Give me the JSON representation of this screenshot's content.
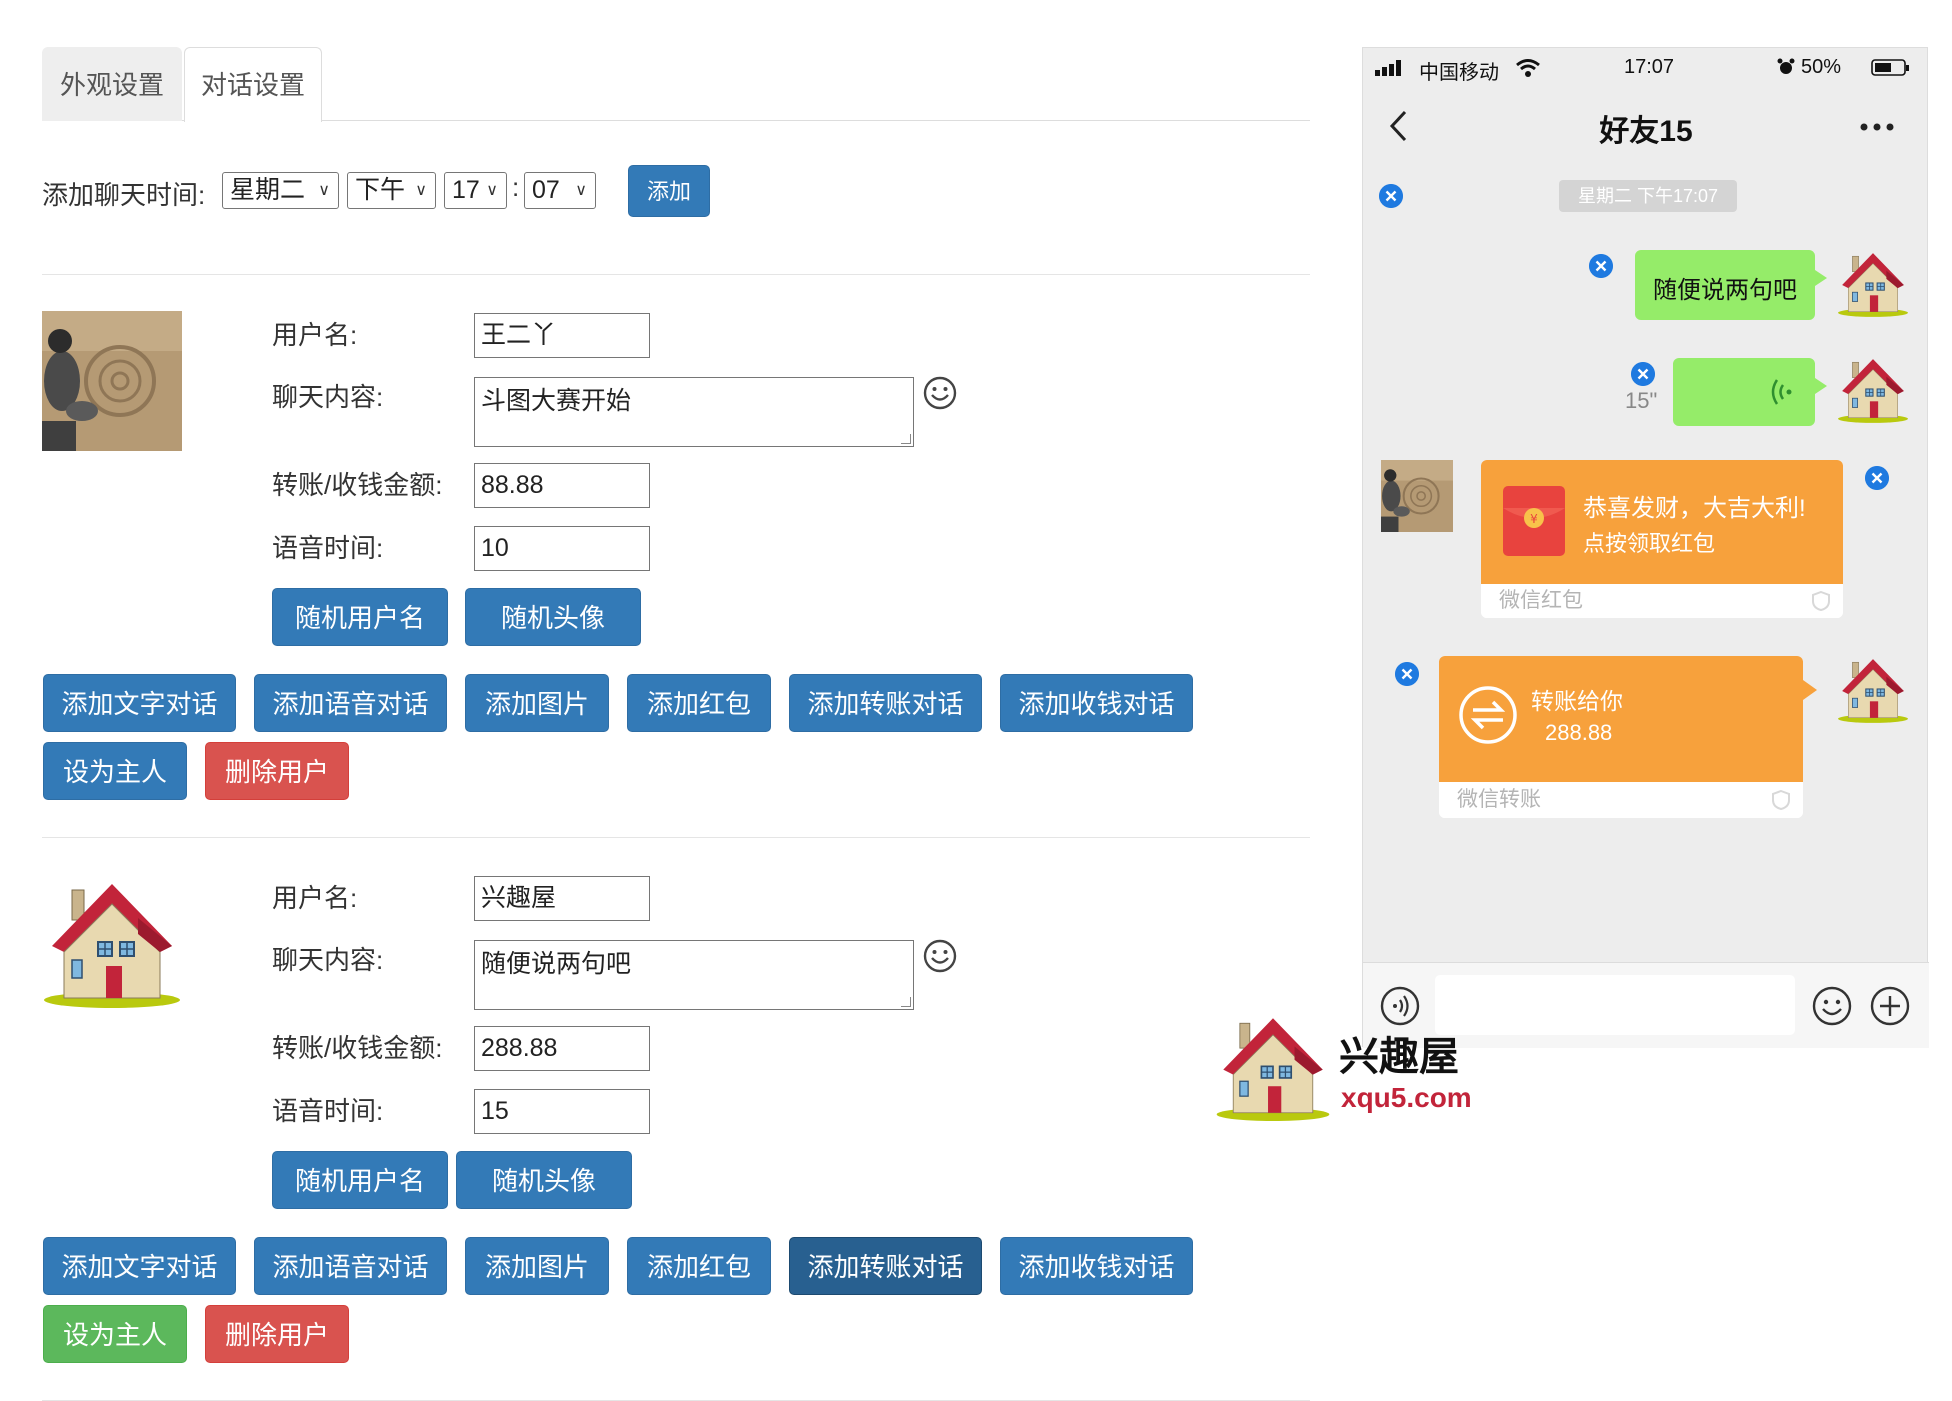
{
  "tabs": [
    {
      "label": "外观设置",
      "active": false
    },
    {
      "label": "对话设置",
      "active": true
    }
  ],
  "time_row": {
    "label": "添加聊天时间:",
    "weekday": "星期二",
    "period": "下午",
    "hour": "17",
    "colon": ":",
    "minute": "07",
    "add_button": "添加"
  },
  "labels": {
    "username": "用户名:",
    "content": "聊天内容:",
    "amount": "转账/收钱金额:",
    "voice_time": "语音时间:",
    "random_name": "随机用户名",
    "random_avatar": "随机头像",
    "add_text": "添加文字对话",
    "add_voice": "添加语音对话",
    "add_image": "添加图片",
    "add_redpacket": "添加红包",
    "add_transfer": "添加转账对话",
    "add_receive": "添加收钱对话",
    "set_owner": "设为主人",
    "delete_user": "删除用户"
  },
  "users": [
    {
      "name": "王二丫",
      "content": "斗图大赛开始",
      "amount": "88.88",
      "voice_time": "10",
      "avatar": "sand-photo"
    },
    {
      "name": "兴趣屋",
      "content": "随便说两句吧",
      "amount": "288.88",
      "voice_time": "15",
      "avatar": "house-icon"
    }
  ],
  "phone": {
    "carrier": "中国移动",
    "clock": "17:07",
    "battery": "50%",
    "chat_title": "好友15",
    "time_stamp": "星期二 下午17:07",
    "text_message": "随便说两句吧",
    "voice_duration": "15\"",
    "redpacket_line1": "恭喜发财，大吉大利!",
    "redpacket_line2": "点按领取红包",
    "redpacket_footer": "微信红包",
    "transfer_title": "转账给你",
    "transfer_amount": "288.88",
    "transfer_footer": "微信转账"
  },
  "watermark": {
    "name": "兴趣屋",
    "domain": "xqu5.com"
  },
  "colors": {
    "primary": "#337ab7",
    "danger": "#d9534f",
    "success": "#5cb85c",
    "wechat_green": "#95ec69",
    "wechat_orange": "#f7a13c",
    "close_blue": "#1f7ae0"
  }
}
